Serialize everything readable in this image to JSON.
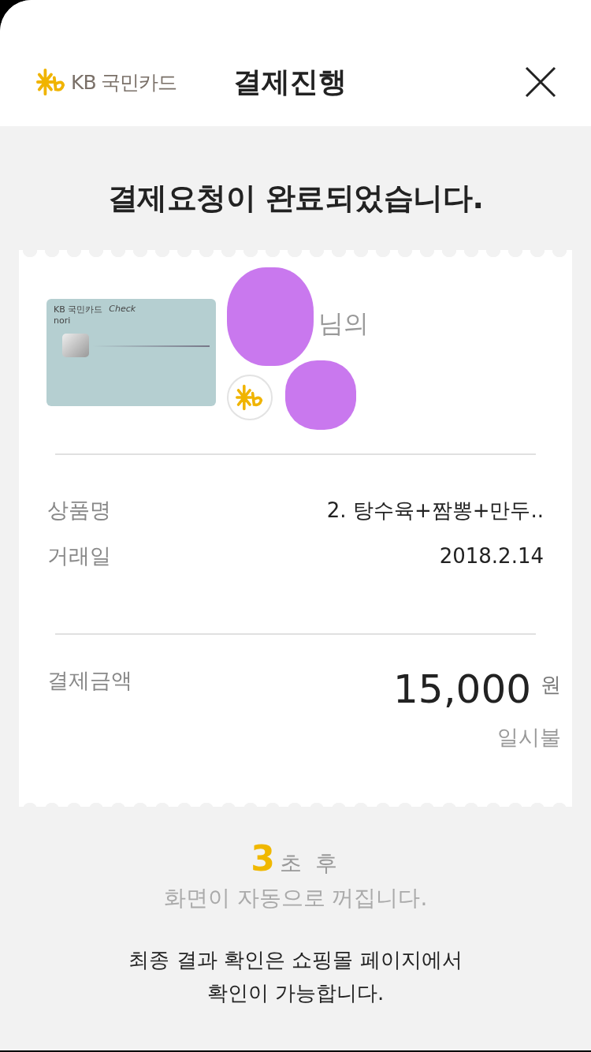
{
  "header": {
    "logo_text": "KB 국민카드",
    "title": "결제진행"
  },
  "headline": "결제요청이 완료되었습니다.",
  "card": {
    "brand": "KB 국민카드",
    "type": "Check",
    "name": "nori",
    "owner_suffix": "님의"
  },
  "details": [
    {
      "label": "상품명",
      "value": "2. 탕수육+짬뽕+만두.."
    },
    {
      "label": "거래일",
      "value": "2018.2.14"
    }
  ],
  "payment": {
    "label": "결제금액",
    "amount": "15,000",
    "unit": "원",
    "installment": "일시불"
  },
  "countdown": {
    "seconds": "3",
    "suffix": "초 후",
    "message": "화면이 자동으로 꺼집니다."
  },
  "notice": [
    "최종 결과 확인은 쇼핑몰 페이지에서",
    "확인이 가능합니다."
  ]
}
